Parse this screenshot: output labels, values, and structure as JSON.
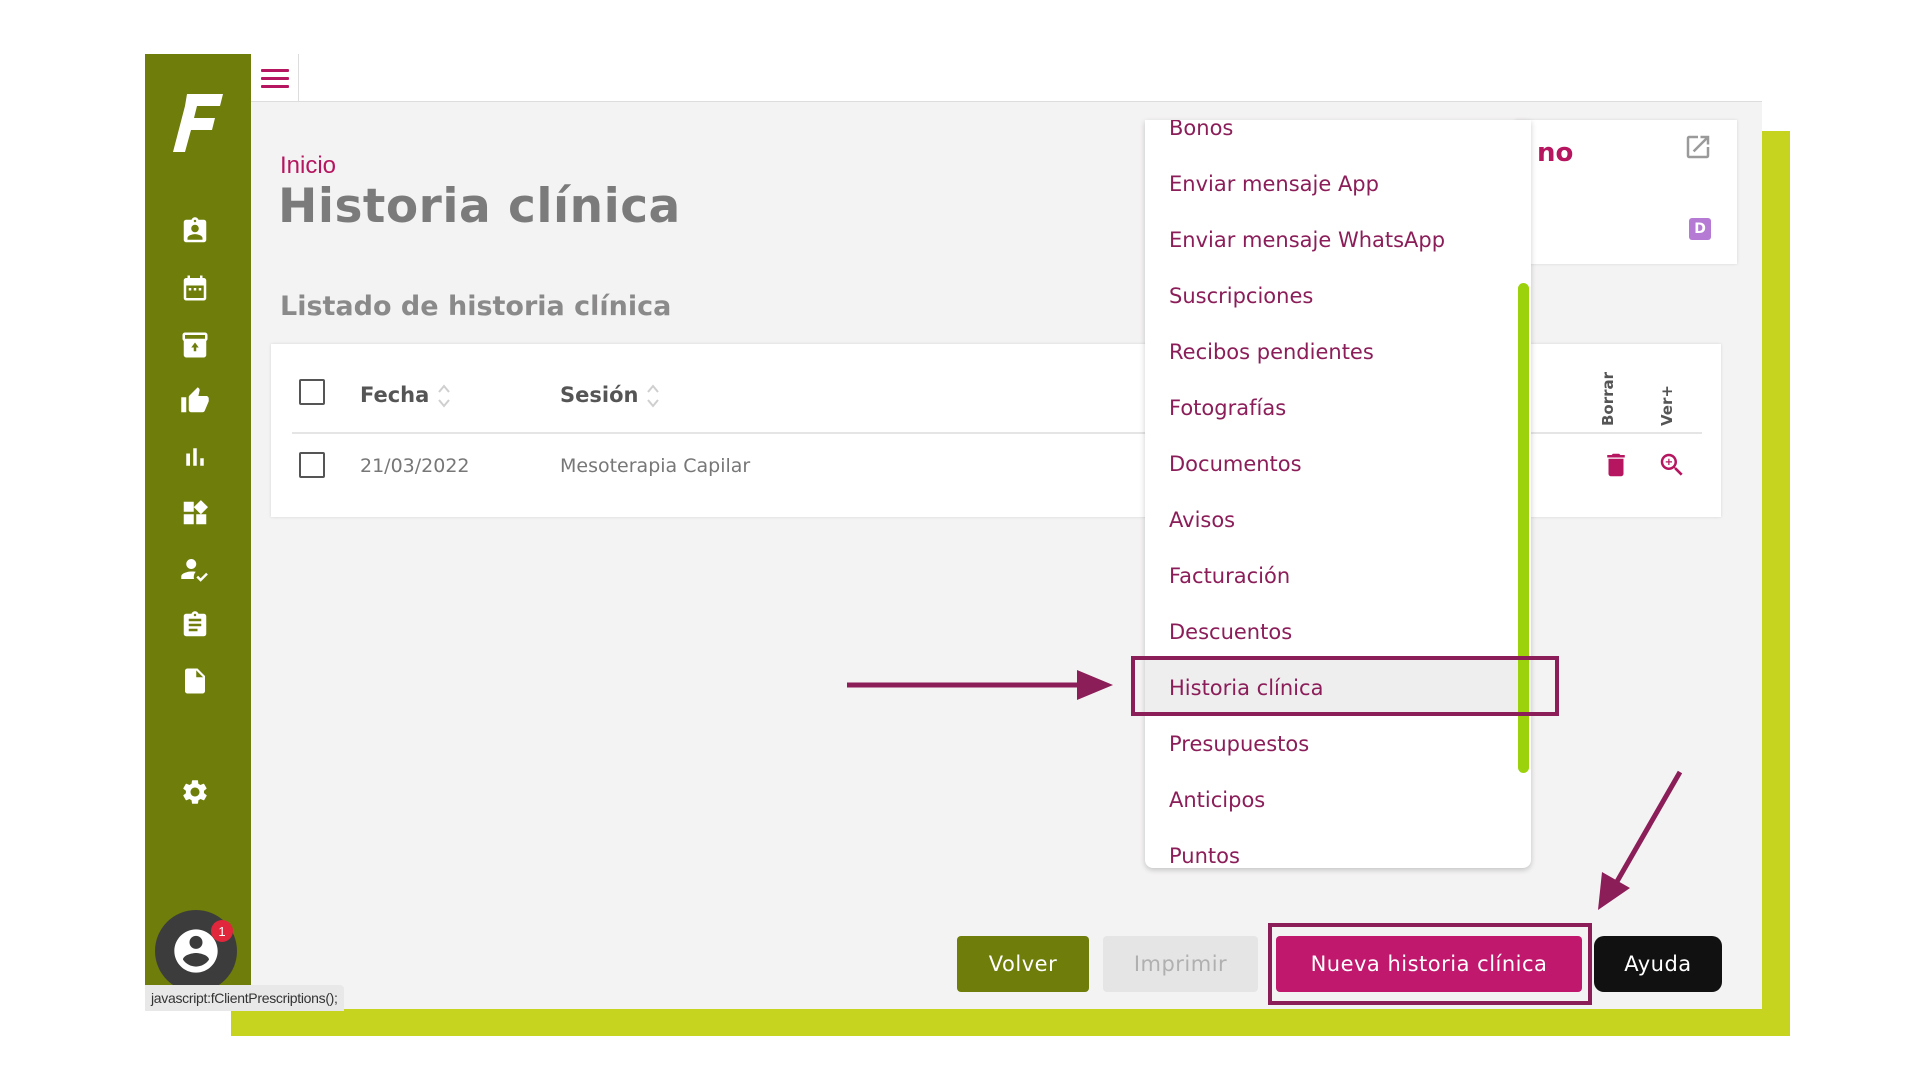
{
  "status_bar": {
    "link_text": "javascript:fClientPrescriptions();"
  },
  "sidebar": {
    "logo": "F",
    "icons": [
      "contact-card-icon",
      "calendar-icon",
      "archive-icon",
      "thumbs-up-icon",
      "bar-chart-icon",
      "widgets-icon",
      "user-check-icon",
      "clipboard-icon",
      "document-icon",
      "settings-icon"
    ],
    "notification_count": "1"
  },
  "header": {
    "breadcrumb": "Inicio",
    "title": "Historia clínica"
  },
  "list": {
    "section_title": "Listado de historia clínica",
    "columns": {
      "fecha": "Fecha",
      "sesion": "Sesión",
      "borrar": "Borrar",
      "ver": "Ver+"
    },
    "rows": [
      {
        "fecha": "21/03/2022",
        "sesion": "Mesoterapia Capilar"
      }
    ]
  },
  "client_card": {
    "name_fragment": "no",
    "badge": "D"
  },
  "dropdown": {
    "items": [
      "Bonos",
      "Enviar mensaje App",
      "Enviar mensaje WhatsApp",
      "Suscripciones",
      "Recibos pendientes",
      "Fotografías",
      "Documentos",
      "Avisos",
      "Facturación",
      "Descuentos",
      "Historia clínica",
      "Presupuestos",
      "Anticipos",
      "Puntos"
    ],
    "active_item": "Historia clínica"
  },
  "buttons": {
    "volver": "Volver",
    "imprimir": "Imprimir",
    "nueva": "Nueva historia clínica",
    "ayuda": "Ayuda"
  },
  "colors": {
    "sidebar": "#6f7d0a",
    "accent": "#b5165f",
    "lime": "#c6d31f",
    "annotation": "#8b1e59"
  }
}
